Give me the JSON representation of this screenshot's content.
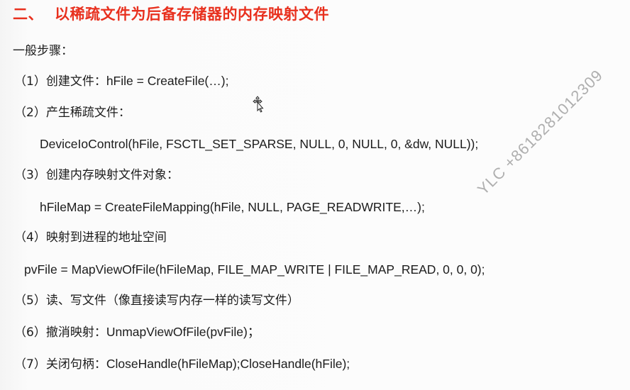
{
  "title": {
    "number": "二、",
    "text": "以稀疏文件为后备存储器的内存映射文件"
  },
  "intro": "一般步骤：",
  "steps": [
    {
      "label": "（1）创建文件：",
      "code": "hFile = CreateFile(…);"
    },
    {
      "label": "（2）产生稀疏文件：",
      "code": ""
    },
    {
      "label": "（3）创建内存映射文件对象：",
      "code": ""
    },
    {
      "label": "（4）映射到进程的地址空间",
      "code": ""
    },
    {
      "label": "（5）读、写文件（像直接读写内存一样的读写文件）",
      "code": ""
    },
    {
      "label": "（6）撤消映射：",
      "code": "UnmapViewOfFile(pvFile)；"
    },
    {
      "label": "（7）关闭句柄：",
      "code": "CloseHandle(hFileMap);CloseHandle(hFile);"
    }
  ],
  "code_lines": {
    "step2": "DeviceIoControl(hFile, FSCTL_SET_SPARSE, NULL, 0, NULL, 0, &dw, NULL));",
    "step3": "hFileMap = CreateFileMapping(hFile, NULL, PAGE_READWRITE,…);",
    "step4": "pvFile = MapViewOfFile(hFileMap, FILE_MAP_WRITE | FILE_MAP_READ, 0, 0, 0);"
  },
  "watermark": "YLC +8618281012309",
  "colors": {
    "title": "#e8301e",
    "text": "#1c1c1c",
    "watermark": "#969696",
    "background": "#fafafa"
  },
  "icons": {
    "cursor": "move-cursor-icon"
  }
}
